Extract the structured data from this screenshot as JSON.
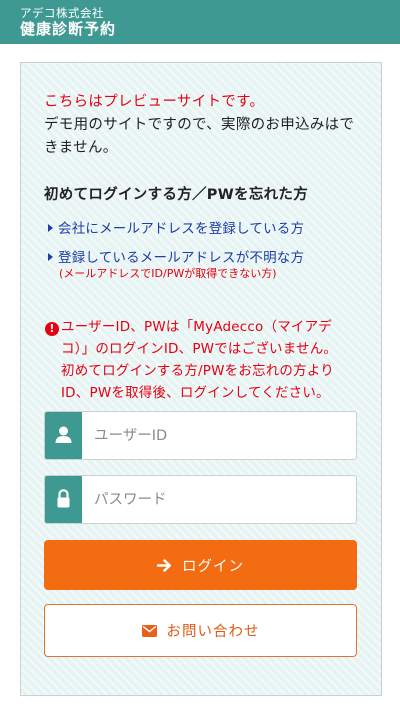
{
  "header": {
    "company": "アデコ株式会社",
    "service": "健康診断予約"
  },
  "notice": {
    "title": "こちらはプレビューサイトです。",
    "body": "デモ用のサイトですので、実際のお申込みはできません。"
  },
  "login_help": {
    "title": "初めてログインする方／PWを忘れた方",
    "links": [
      {
        "label": "会社にメールアドレスを登録している方"
      },
      {
        "label": "登録しているメールアドレスが不明な方"
      }
    ],
    "note": "(メールアドレスでID/PWが取得できない方)"
  },
  "warning": {
    "icon": "exclamation-icon",
    "lines": [
      "ユーザーID、PWは「MyAdecco（マイアデ",
      "コ）」のログインID、PWではございません。",
      "初めてログインする方/PWをお忘れの方より",
      "ID、PWを取得後、ログインしてください。"
    ]
  },
  "form": {
    "user_id": {
      "placeholder": "ユーザーID",
      "value": "",
      "icon": "user-icon"
    },
    "password": {
      "placeholder": "パスワード",
      "value": "",
      "icon": "lock-icon"
    },
    "login_label": "ログイン",
    "contact_label": "お問い合わせ"
  },
  "colors": {
    "header_bg": "#3f9993",
    "card_bg": "#e6f4f3",
    "alert_red": "#e60012",
    "link_blue": "#1e3da6",
    "login_orange": "#f36c12"
  }
}
